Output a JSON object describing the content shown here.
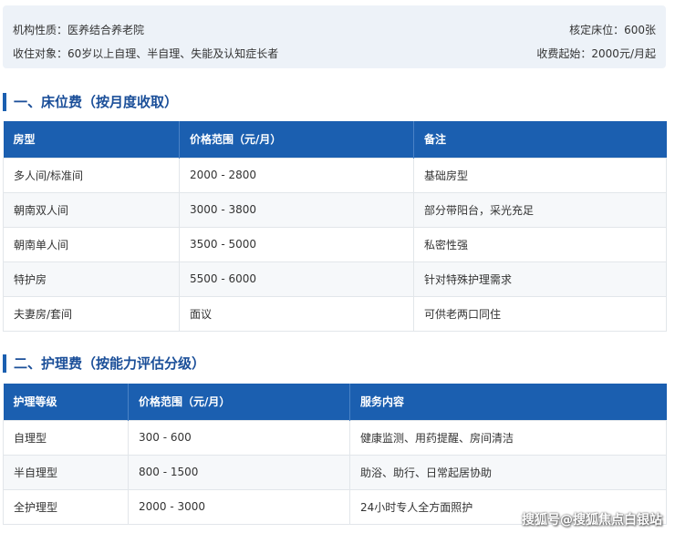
{
  "info": {
    "nature_label": "机构性质：医养结合养老院",
    "beds_label": "核定床位：600张",
    "target_label": "收住对象：60岁以上自理、半自理、失能及认知症长者",
    "fee_start_label": "收费起始：2000元/月起"
  },
  "section1": {
    "title": "一、床位费（按月度收取）",
    "headers": [
      "房型",
      "价格范围（元/月）",
      "备注"
    ],
    "rows": [
      [
        "多人间/标准间",
        "2000 - 2800",
        "基础房型"
      ],
      [
        "朝南双人间",
        "3000 - 3800",
        "部分带阳台，采光充足"
      ],
      [
        "朝南单人间",
        "3500 - 5000",
        "私密性强"
      ],
      [
        "特护房",
        "5500 - 6000",
        "针对特殊护理需求"
      ],
      [
        "夫妻房/套间",
        "面议",
        "可供老两口同住"
      ]
    ]
  },
  "section2": {
    "title": "二、护理费（按能力评估分级）",
    "headers": [
      "护理等级",
      "价格范围（元/月）",
      "服务内容"
    ],
    "rows": [
      [
        "自理型",
        "300 - 600",
        "健康监测、用药提醒、房间清洁"
      ],
      [
        "半自理型",
        "800 - 1500",
        "助浴、助行、日常起居协助"
      ],
      [
        "全护理型",
        "2000 - 3000",
        "24小时专人全方面照护"
      ]
    ]
  },
  "watermark": "搜狐号@搜狐焦点白银站"
}
